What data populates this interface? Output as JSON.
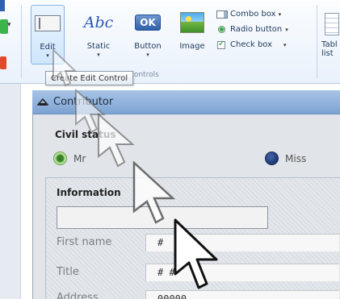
{
  "ribbon": {
    "buttons": [
      {
        "label": "Edit",
        "icon": "edit-control-icon"
      },
      {
        "label": "Static",
        "icon": "static-text-icon",
        "icon_text": "Abc"
      },
      {
        "label": "Button",
        "icon": "button-control-icon",
        "icon_text": "OK"
      },
      {
        "label": "Image",
        "icon": "image-control-icon"
      }
    ],
    "side_items": [
      {
        "label": "Combo box",
        "icon": "combo-box-icon"
      },
      {
        "label": "Radio button",
        "icon": "radio-button-icon"
      },
      {
        "label": "Check box",
        "icon": "check-box-icon"
      }
    ],
    "table_button": {
      "label_line1": "Tabl",
      "label_line2": "list"
    },
    "group_label": "al controls",
    "tooltip": "Create Edit Control"
  },
  "window": {
    "title": "Contributor",
    "civil_status": {
      "title": "Civil status",
      "options": [
        "Mr",
        "Miss"
      ]
    },
    "information": {
      "title": "Information",
      "rows": [
        {
          "label": "First name",
          "value": "#"
        },
        {
          "label": "Title",
          "value": "# #"
        },
        {
          "label": "Address",
          "value": "00000"
        }
      ]
    }
  },
  "colors": {
    "ribbon_bg": "#e9f1fb",
    "titlebar": "#7ea3d3",
    "window_bg": "#e1e4e8",
    "radio_selected": "#3a7f2b",
    "radio_dark": "#1d3b78"
  }
}
